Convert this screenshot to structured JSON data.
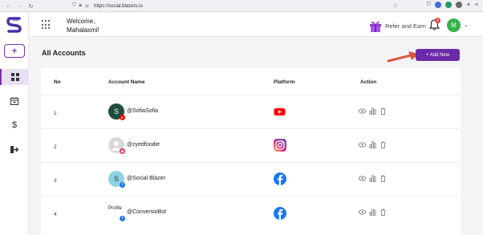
{
  "browser": {
    "url": "https://social.blazers.io"
  },
  "sidebar": {
    "add_label": "+",
    "items": [
      {
        "name": "dashboard",
        "icon": "grid-icon"
      },
      {
        "name": "calendar",
        "icon": "calendar-icon"
      },
      {
        "name": "billing",
        "icon": "dollar-icon"
      },
      {
        "name": "logout",
        "icon": "logout-icon"
      }
    ]
  },
  "header": {
    "welcome_line1": "Welcome,",
    "welcome_line2": "Mahalaxmi!",
    "refer_label": "Refer and Earn",
    "notification_count": "6",
    "avatar_initial": "M"
  },
  "main": {
    "title": "All Accounts",
    "add_button": "+ Add New"
  },
  "table": {
    "headers": {
      "no": "No",
      "account_name": "Account Name",
      "platform": "Platform",
      "action": "Action"
    },
    "rows": [
      {
        "no": "1",
        "avatar_initial": "S",
        "avatar_color": "#1f4d3f",
        "handle": "@SofiaSofia",
        "platform": "youtube"
      },
      {
        "no": "2",
        "avatar_initial": "",
        "avatar_color": "#d9d9d9",
        "handle": "@zyedfoodie",
        "platform": "instagram"
      },
      {
        "no": "3",
        "avatar_initial": "S",
        "avatar_color": "#8fd2e0",
        "handle": "@Social Blazer",
        "platform": "facebook"
      },
      {
        "no": "4",
        "avatar_initial": "",
        "avatar_color": "",
        "profile_label": "Profile",
        "handle": "@ConversioBot",
        "platform": "facebook"
      }
    ]
  },
  "colors": {
    "accent": "#6a2aa8",
    "youtube": "#ff0000",
    "facebook": "#1877f2",
    "arrow": "#e0533f"
  }
}
